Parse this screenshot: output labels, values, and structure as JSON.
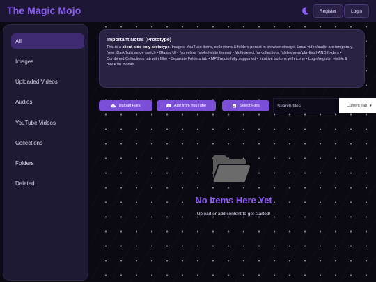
{
  "header": {
    "logo": "The Magic Mojo",
    "theme_toggle_icon": "moon-icon",
    "register_label": "Register",
    "login_label": "Login"
  },
  "sidebar": {
    "items": [
      {
        "label": "All",
        "active": true
      },
      {
        "label": "Images",
        "active": false
      },
      {
        "label": "Uploaded Videos",
        "active": false
      },
      {
        "label": "Audios",
        "active": false
      },
      {
        "label": "YouTube Videos",
        "active": false
      },
      {
        "label": "Collections",
        "active": false
      },
      {
        "label": "Folders",
        "active": false
      },
      {
        "label": "Deleted",
        "active": false
      }
    ]
  },
  "notes": {
    "title": "Important Notes (Prototype)",
    "line1_prefix": "This is a ",
    "line1_bold": "client-side only prototype",
    "line1_suffix": ". Images, YouTube items, collections & folders persist in browser storage. Local video/audio are temporary.",
    "line2": "New: Dark/light mode switch • Glassy UI • No yellow (violet/white theme) • Multi-select for collections (slideshows/playlists) AND folders • Combined Collections tab with filter • Separate Folders tab • MP3/audio fully supported • Intuitive buttons with icons • Login/register visible & mock on mobile."
  },
  "actions": {
    "upload_label": "Upload Files",
    "youtube_label": "Add from YouTube",
    "select_label": "Select Files",
    "search_placeholder": "Search files...",
    "tab_select_value": "Current Tab",
    "icons": [
      "cloud-upload-icon",
      "video-icon",
      "checkbox-icon",
      "chevron-down-icon"
    ]
  },
  "empty": {
    "icon": "open-folder-icon",
    "title": "No Items Here Yet",
    "subtitle": "Upload or add content to get started!"
  },
  "colors": {
    "accent": "#8b5cf6",
    "button": "#7c4fd8",
    "header_bg": "#1d1634",
    "panel_bg": "#1f1a33",
    "page_bg": "#0b0911"
  }
}
